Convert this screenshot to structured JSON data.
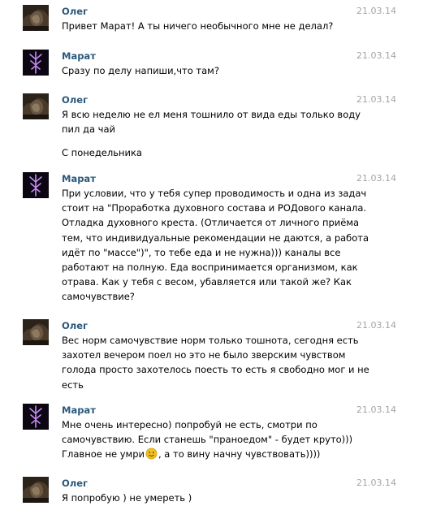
{
  "messages": [
    {
      "author": "Олег",
      "avatar_icon": "oleg-dark-photo-avatar",
      "date": "21.03.14",
      "paragraphs": [
        [
          "Привет Марат! А ты ничего необычного мне не делал?"
        ]
      ]
    },
    {
      "author": "Марат",
      "avatar_icon": "marat-purple-rune-avatar",
      "date": "21.03.14",
      "paragraphs": [
        [
          "Сразу по делу напиши,что там?"
        ]
      ]
    },
    {
      "author": "Олег",
      "avatar_icon": "oleg-dark-photo-avatar",
      "date": "21.03.14",
      "paragraphs": [
        [
          "Я всю неделю не ел меня тошнило от вида еды только воду",
          "пил да чай"
        ],
        [
          "С понедельника"
        ]
      ]
    },
    {
      "author": "Марат",
      "avatar_icon": "marat-purple-rune-avatar",
      "date": "21.03.14",
      "paragraphs": [
        [
          "При условии, что у тебя супер проводимость и одна из задач",
          "стоит на \"Проработка духовного состава и РОДового канала.",
          "Отладка духовного креста. (Отличается от личного приёма",
          "тем, что индивидуальные рекомендации не даются, а работа",
          "идёт по \"массе\")\", то тебе еда и не нужна))) каналы все",
          "работают на полную. Еда воспринимается организмом, как",
          "отрава. Как у тебя с весом, убавляется или такой же? Как",
          "самочувствие?"
        ]
      ]
    },
    {
      "author": "Олег",
      "avatar_icon": "oleg-dark-photo-avatar",
      "date": "21.03.14",
      "paragraphs": [
        [
          "Вес норм самочувствие норм только тошнота, сегодня есть",
          "захотел вечером поел но это не было зверским чувством",
          "голода просто захотелось поесть то есть я свободно мог и не",
          "есть"
        ]
      ]
    },
    {
      "author": "Марат",
      "avatar_icon": "marat-purple-rune-avatar",
      "date": "21.03.14",
      "paragraphs": [
        [
          "Мне очень интересно) попробуй не есть, смотри по",
          "самочувствию. Если станешь \"праноедом\" - будет круто)))",
          "Главное не умри{emoji}, а то вину начну чувствовать))))"
        ]
      ],
      "emoji_icon": "smiley-emoji-icon"
    },
    {
      "author": "Олег",
      "avatar_icon": "oleg-dark-photo-avatar",
      "date": "21.03.14",
      "paragraphs": [
        [
          "Я попробую ) не умереть )"
        ]
      ]
    }
  ],
  "colors": {
    "author": "#2b587a",
    "date": "#a0a5aa",
    "text": "#000000",
    "rune": "#c38cf0",
    "emoji": "#f2c21b"
  }
}
